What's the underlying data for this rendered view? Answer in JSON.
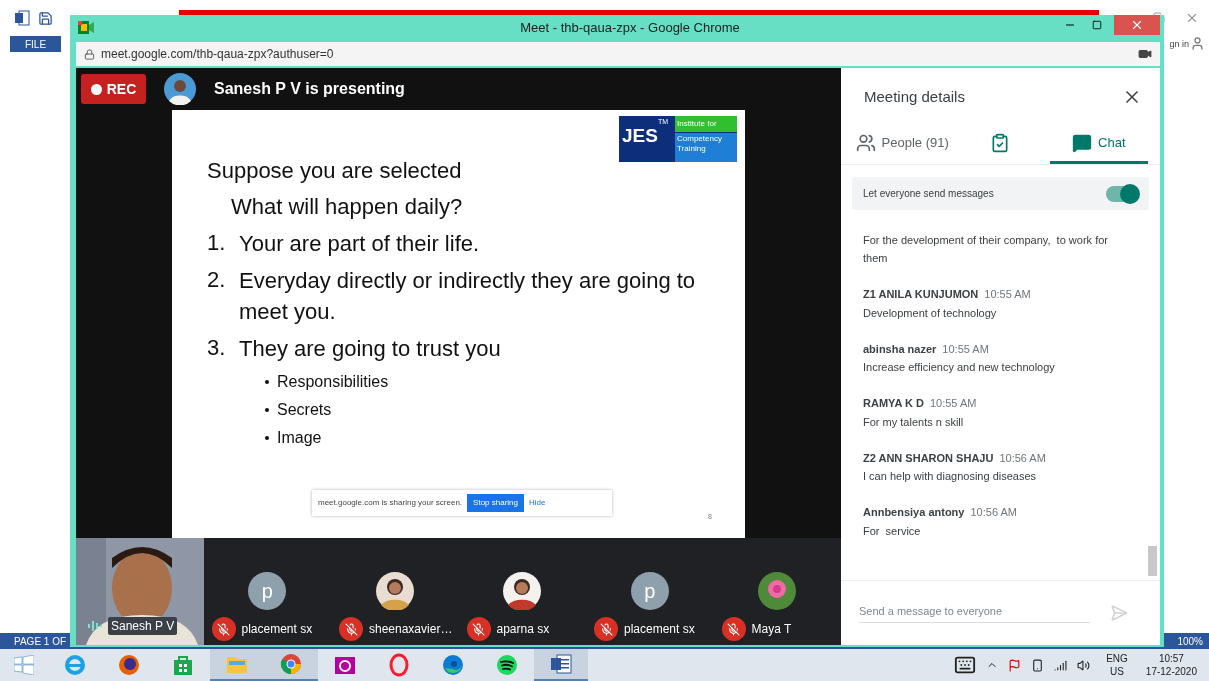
{
  "background_app": {
    "file_tab": "FILE",
    "sign_in": "gn in",
    "status_left": "PAGE 1 OF",
    "zoom": "100%"
  },
  "browser": {
    "title": "Meet - thb-qaua-zpx - Google Chrome",
    "url": "meet.google.com/thb-qaua-zpx?authuser=0"
  },
  "meet": {
    "rec_label": "REC",
    "presenting": "Sanesh P V is presenting",
    "slide": {
      "title": "Suppose you are selected",
      "subtitle": "What will happen daily?",
      "items": [
        {
          "number": "1.",
          "text": "Your are part of their life."
        },
        {
          "number": "2.",
          "text": "Everyday directly or indirectly they are going to meet you."
        },
        {
          "number": "3.",
          "text": "They are going to trust you"
        }
      ],
      "bullets": [
        "Responsibilities",
        "Secrets",
        "Image"
      ],
      "logo": {
        "text": "JES",
        "tm": "TM",
        "line1": "Institute for",
        "line2": "Competency Training"
      },
      "share_notice": {
        "text": "meet.google.com is sharing your screen.",
        "stop": "Stop sharing",
        "hide": "Hide"
      },
      "page": "8"
    },
    "presenter": {
      "name": "Sanesh P V"
    },
    "participants": [
      {
        "name": "placement sx",
        "kind": "letter",
        "letter": "p",
        "muted": true
      },
      {
        "name": "sheenaxavier…",
        "muted": true
      },
      {
        "name": "aparna sx",
        "muted": true
      },
      {
        "name": "placement sx",
        "kind": "letter",
        "letter": "p",
        "muted": true
      },
      {
        "name": "Maya T",
        "kind": "flower",
        "muted": true
      }
    ]
  },
  "panel": {
    "title": "Meeting details",
    "tabs": [
      {
        "kind": "people",
        "label": "People (91)",
        "selected": false
      },
      {
        "kind": "activities",
        "selected": false
      },
      {
        "kind": "chat",
        "label": "Chat",
        "selected": true
      }
    ],
    "toggle": {
      "label": "Let everyone send messages",
      "on": true
    },
    "messages": [
      {
        "text": "For the development of their company,  to work for them"
      },
      {
        "author": "Z1 ANILA KUNJUMON",
        "time": "10:55 AM",
        "text": "Development of technology"
      },
      {
        "author": "abinsha nazer",
        "time": "10:55 AM",
        "text": "Increase efficiency and new technology"
      },
      {
        "author": "RAMYA K D",
        "time": "10:55 AM",
        "text": "For my talents n skill"
      },
      {
        "author": "Z2 ANN SHARON SHAJU",
        "time": "10:56 AM",
        "text": "I can help with diagnosing diseases"
      },
      {
        "author": "Annbensiya antony",
        "time": "10:56 AM",
        "text": "For  service"
      }
    ],
    "input_placeholder": "Send a message to everyone"
  },
  "taskbar": {
    "apps": [
      {
        "kind": "ie",
        "open": false
      },
      {
        "kind": "firefox",
        "open": false
      },
      {
        "kind": "store",
        "open": false
      },
      {
        "kind": "explorer",
        "open": true
      },
      {
        "kind": "chrome",
        "open": true
      },
      {
        "kind": "camera",
        "open": false
      },
      {
        "kind": "opera",
        "open": false
      },
      {
        "kind": "edge",
        "open": false
      },
      {
        "kind": "spotify",
        "open": false
      },
      {
        "kind": "word",
        "open": true
      }
    ],
    "lang": "ENG",
    "region": "US",
    "time": "10:57",
    "date": "17-12-2020"
  }
}
